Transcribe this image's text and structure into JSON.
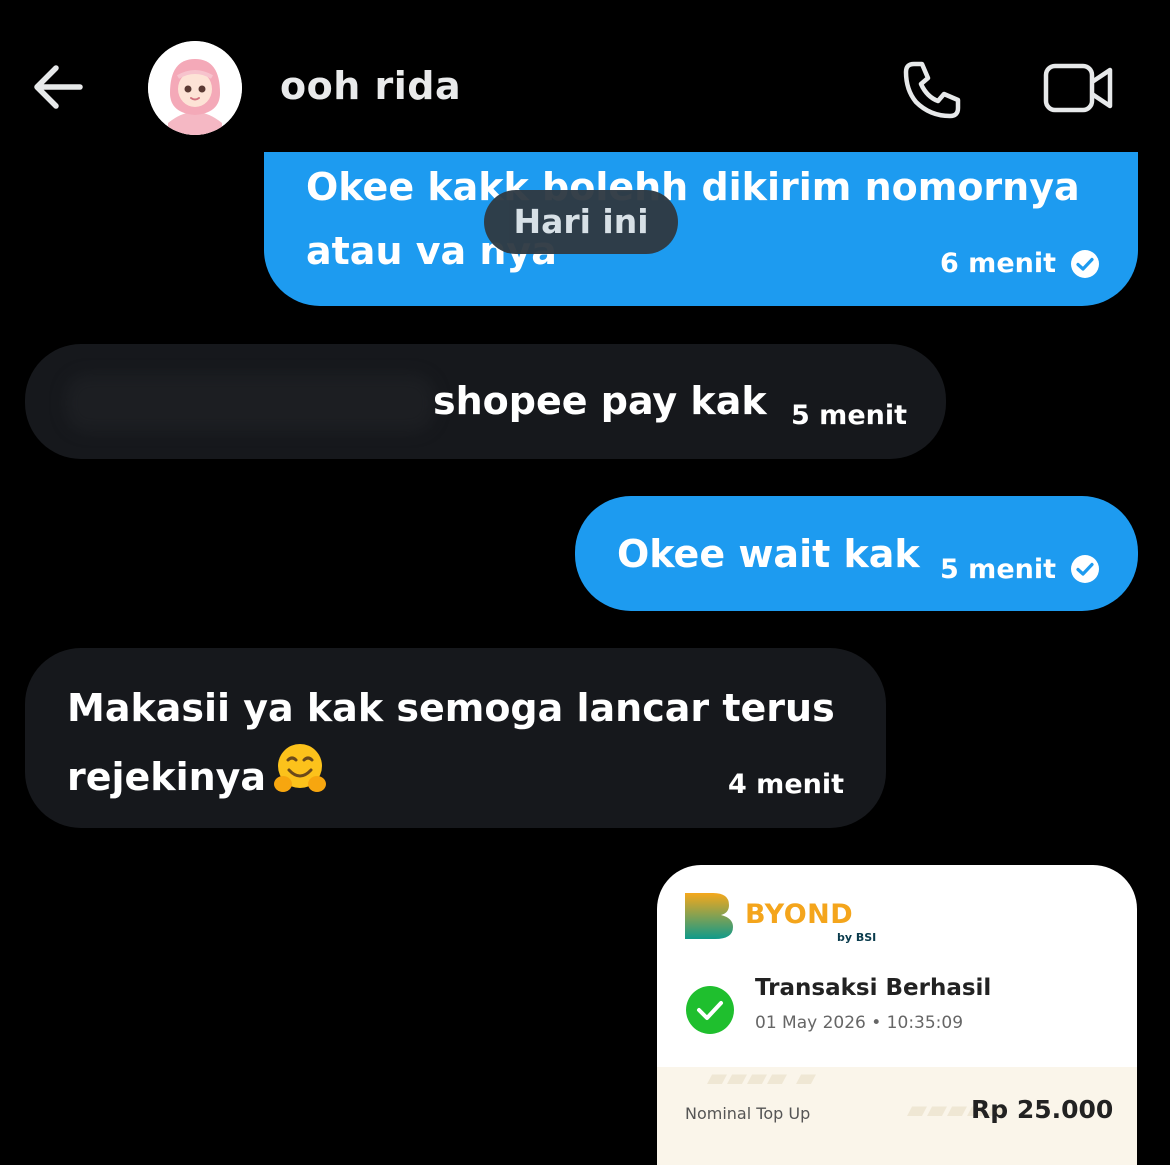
{
  "header": {
    "contact_name": "ooh rida",
    "back_icon": "arrow-left-icon",
    "call_icon": "phone-icon",
    "video_icon": "video-camera-icon"
  },
  "messages": [
    {
      "direction": "outgoing",
      "text": "Okee kakk bolehh dikirim nomornya atau va nya",
      "time": "6 menit",
      "status_icon": "check-circle-icon"
    },
    {
      "direction": "incoming",
      "text": "shopee pay kak",
      "time": "5 menit"
    },
    {
      "direction": "outgoing",
      "text": "Okee wait kak",
      "time": "5 menit",
      "status_icon": "check-circle-icon"
    },
    {
      "direction": "incoming",
      "text": "Makasii ya kak semoga lancar terus rejekinya",
      "emoji": "hugging-face-emoji",
      "time": "4 menit"
    }
  ],
  "day_divider": "Hari ini",
  "receipt": {
    "brand": "BYOND",
    "brand_sub": "by BSI",
    "status": "Transaksi Berhasil",
    "datetime": "01 May 2026 • 10:35:09",
    "nominal_label": "Nominal Top Up",
    "nominal_value": "Rp 25.000"
  },
  "colors": {
    "background": "#000000",
    "outgoing_bubble": "#1d9bf0",
    "incoming_bubble": "#16181c",
    "brand_orange": "#f4a51c",
    "success_green": "#1fbf2e"
  }
}
